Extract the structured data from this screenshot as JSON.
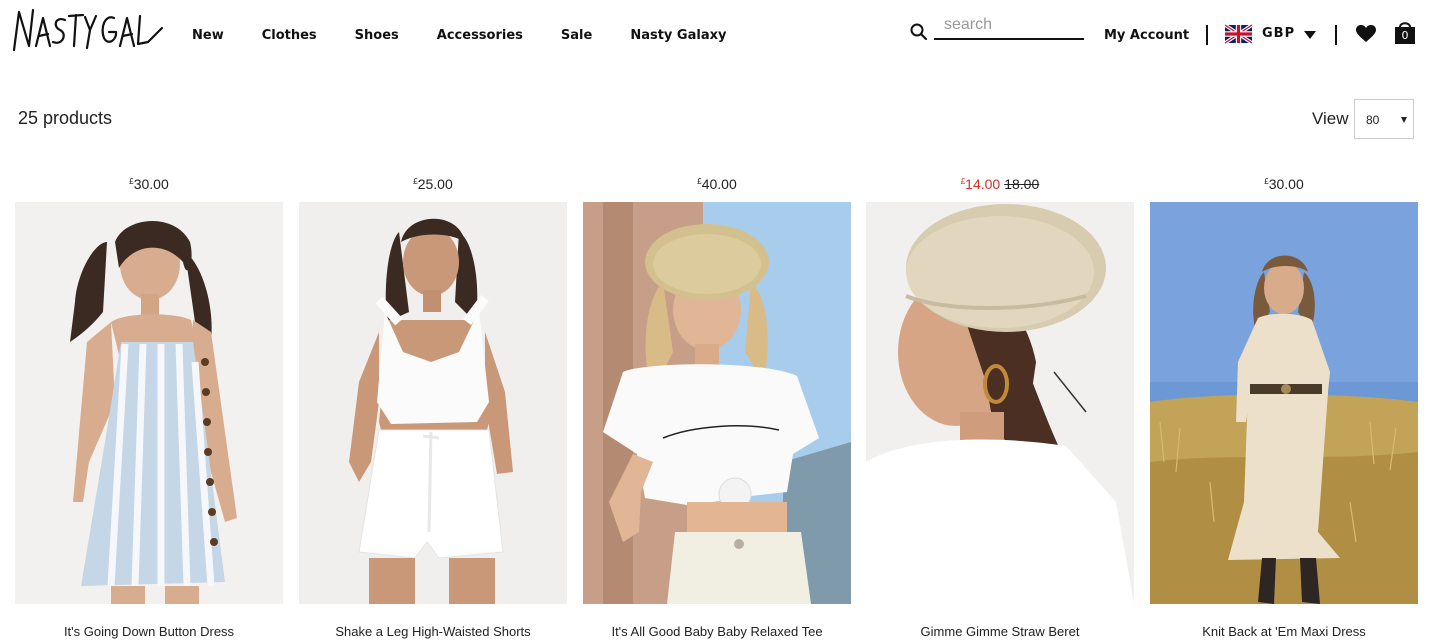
{
  "brand": {
    "logo_text": "Nasty Gal"
  },
  "nav": [
    "New",
    "Clothes",
    "Shoes",
    "Accessories",
    "Sale",
    "Nasty Galaxy"
  ],
  "search": {
    "placeholder": "search"
  },
  "account": {
    "label": "My Account"
  },
  "currency": {
    "code": "GBP",
    "flag": "uk-flag-icon"
  },
  "bag": {
    "count": "0"
  },
  "toolbar": {
    "product_count": "25 products",
    "view_label": "View",
    "view_value": "80"
  },
  "colors": {
    "sale_red": "#d0312d",
    "text": "#111111"
  },
  "products": [
    {
      "price_symbol": "£",
      "price": "30.00",
      "name": "It's Going Down Button Dress"
    },
    {
      "price_symbol": "£",
      "price": "25.00",
      "name": "Shake a Leg High-Waisted Shorts"
    },
    {
      "price_symbol": "£",
      "price": "40.00",
      "name": "It's All Good Baby Baby Relaxed Tee"
    },
    {
      "price_symbol": "£",
      "sale_price": "14.00",
      "original_price": "18.00",
      "name": "Gimme Gimme Straw Beret"
    },
    {
      "price_symbol": "£",
      "price": "30.00",
      "name": "Knit Back at 'Em Maxi Dress"
    }
  ]
}
